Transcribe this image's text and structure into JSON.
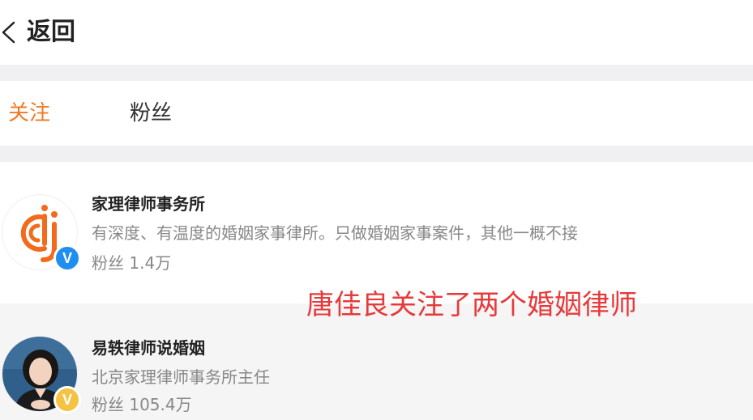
{
  "header": {
    "back_label": "返回"
  },
  "tabs": [
    {
      "label": "关注",
      "active": true
    },
    {
      "label": "粉丝",
      "active": false
    }
  ],
  "users": [
    {
      "name": "家理律师事务所",
      "description": "有深度、有温度的婚姻家事律所。只做婚姻家事案件，其他一概不接",
      "fans": "粉丝 1.4万",
      "badge_color": "#1f8ef1",
      "badge_symbol": "V"
    },
    {
      "name": "易轶律师说婚姻",
      "description": "北京家理律师事务所主任",
      "fans": "粉丝 105.4万",
      "badge_color": "#f5c242",
      "badge_symbol": "V"
    }
  ],
  "annotation": "唐佳良关注了两个婚姻律师",
  "colors": {
    "accent": "#f07a24",
    "annotation": "#e8393a"
  }
}
